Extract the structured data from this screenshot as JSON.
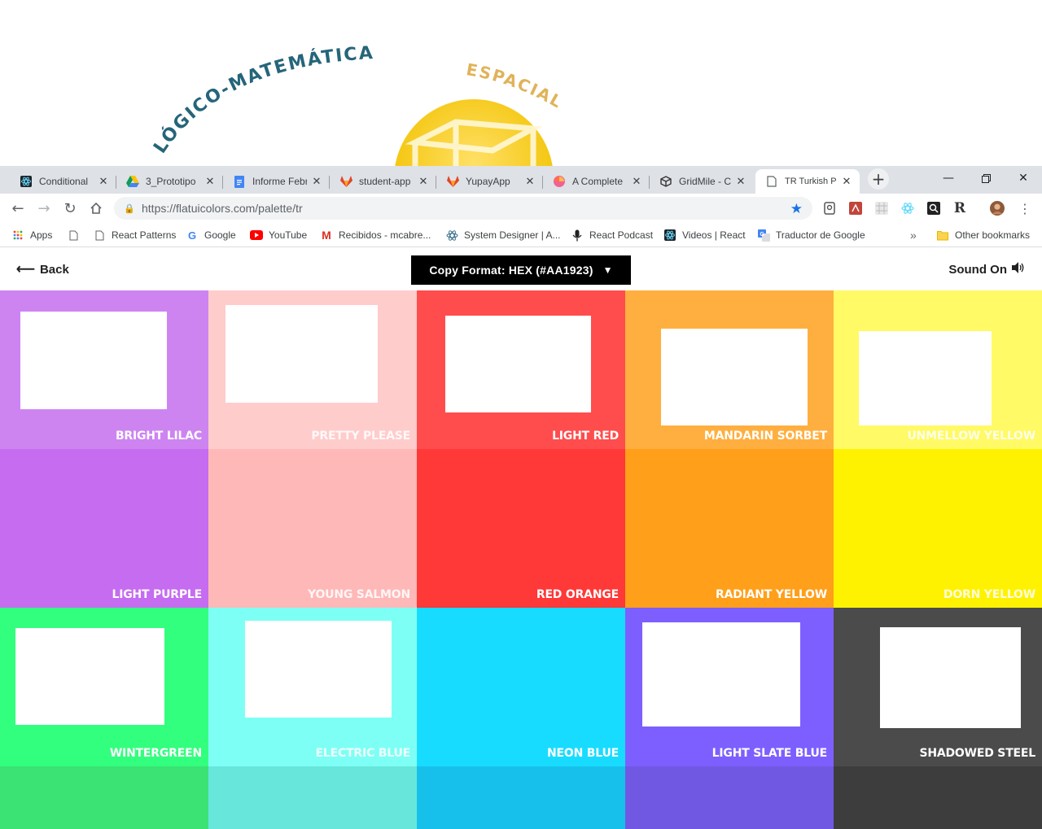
{
  "banner": {
    "arc_text_1": "LÓGICO-MATEMÁTICA",
    "arc_text_2": "ESPACIAL"
  },
  "tabs": [
    {
      "title": "Conditional",
      "icon": "react-icon",
      "active": false
    },
    {
      "title": "3_Prototipo",
      "icon": "google-drive-icon",
      "active": false
    },
    {
      "title": "Informe Febr",
      "icon": "google-docs-icon",
      "active": false
    },
    {
      "title": "student-app",
      "icon": "gitlab-icon",
      "active": false
    },
    {
      "title": "YupayApp",
      "icon": "gitlab-icon",
      "active": false
    },
    {
      "title": "A Complete",
      "icon": "pinwheel-icon",
      "active": false
    },
    {
      "title": "GridMile - C",
      "icon": "cube-icon",
      "active": false
    },
    {
      "title": "TR Turkish Pa",
      "icon": "page-icon",
      "active": true
    }
  ],
  "toolbar": {
    "url": "https://flatuicolors.com/palette/tr"
  },
  "bookmarks": [
    {
      "label": "Apps",
      "icon": "apps-grid-icon"
    },
    {
      "label": "",
      "icon": "page-icon"
    },
    {
      "label": "React Patterns",
      "icon": "page-icon"
    },
    {
      "label": "Google",
      "icon": "google-icon"
    },
    {
      "label": "YouTube",
      "icon": "youtube-icon"
    },
    {
      "label": "Recibidos - mcabre...",
      "icon": "gmail-icon"
    },
    {
      "label": "System Designer | A...",
      "icon": "atom-icon"
    },
    {
      "label": "React Podcast",
      "icon": "microphone-icon"
    },
    {
      "label": "Videos | React",
      "icon": "react-icon"
    },
    {
      "label": "Traductor de Google",
      "icon": "translate-icon"
    }
  ],
  "bookmarks_overflow": "»",
  "other_bookmarks": "Other bookmarks",
  "nav": {
    "back_label": "Back",
    "copy_format_label": "Copy Format: HEX (#AA1923)",
    "sound_label": "Sound On"
  },
  "palette": [
    {
      "name": "BRIGHT LILAC",
      "color": "#cd84f1",
      "band": "#cd84f1"
    },
    {
      "name": "PRETTY PLEASE",
      "color": "#ffcccc",
      "band": "#ffcccc"
    },
    {
      "name": "LIGHT RED",
      "color": "#ff4d4d",
      "band": "#ff4d4d"
    },
    {
      "name": "MANDARIN SORBET",
      "color": "#ffaf40",
      "band": "#ffaf40"
    },
    {
      "name": "UNMELLOW YELLOW",
      "color": "#fffa65",
      "band": "#fffa65"
    },
    {
      "name": "LIGHT PURPLE",
      "color": "#c56cf0",
      "band": "#c56cf0"
    },
    {
      "name": "YOUNG SALMON",
      "color": "#ffb8b8",
      "band": "#ffb8b8"
    },
    {
      "name": "RED ORANGE",
      "color": "#ff3838",
      "band": "#ff3838"
    },
    {
      "name": "RADIANT YELLOW",
      "color": "#ff9f1a",
      "band": "#ff9f1a"
    },
    {
      "name": "DORN YELLOW",
      "color": "#fff200",
      "band": "#fff200"
    },
    {
      "name": "WINTERGREEN",
      "color": "#32ff7e",
      "band": "#3ae374"
    },
    {
      "name": "ELECTRIC BLUE",
      "color": "#7efff5",
      "band": "#67e6dc"
    },
    {
      "name": "NEON BLUE",
      "color": "#18dcff",
      "band": "#17c0eb"
    },
    {
      "name": "LIGHT SLATE BLUE",
      "color": "#7d5fff",
      "band": "#7158e2"
    },
    {
      "name": "SHADOWED STEEL",
      "color": "#4b4b4b",
      "band": "#3d3d3d"
    }
  ]
}
